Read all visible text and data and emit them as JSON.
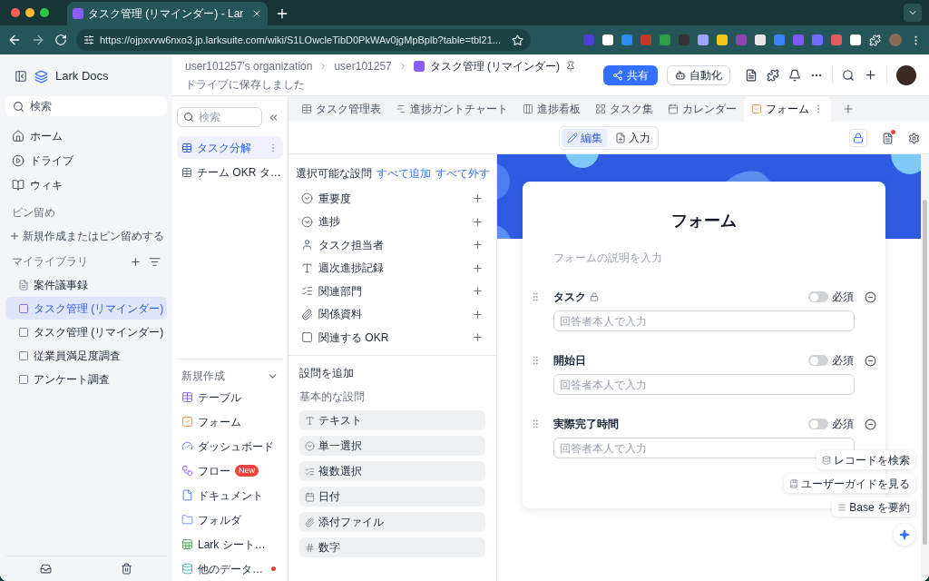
{
  "browser": {
    "tab_title": "タスク管理 (リマインダー) - Lar",
    "url": "https://ojpxvvw6nxo3.jp.larksuite.com/wiki/S1LOwcleTibD0PkWAv0jgMpBplb?table=tbl21..."
  },
  "sidebar": {
    "app_name": "Lark Docs",
    "search_placeholder": "検索",
    "nav": [
      {
        "label": "ホーム",
        "kind": "home"
      },
      {
        "label": "ドライブ",
        "kind": "drive"
      },
      {
        "label": "ウィキ",
        "kind": "wiki"
      }
    ],
    "pinned_heading": "ピン留め",
    "pin_action": "新規作成またはピン留めする",
    "library_heading": "マイライブラリ",
    "library": [
      {
        "label": "案件議事録",
        "kind": "doc",
        "selected": false
      },
      {
        "label": "タスク管理 (リマインダー)",
        "kind": "base",
        "selected": true
      },
      {
        "label": "タスク管理 (リマインダー)",
        "kind": "base",
        "selected": false
      },
      {
        "label": "従業員満足度調査",
        "kind": "base",
        "selected": false
      },
      {
        "label": "アンケート調査",
        "kind": "base",
        "selected": false
      }
    ]
  },
  "header": {
    "breadcrumb": [
      "user101257's organization",
      "user101257"
    ],
    "doc_title": "タスク管理 (リマインダー)",
    "saved_note": "ドライブに保存しました",
    "share_button": "共有",
    "automate_button": "自動化"
  },
  "tables_panel": {
    "search_placeholder": "検索",
    "tables": [
      {
        "label": "タスク分解",
        "selected": true
      },
      {
        "label": "チーム OKR タ…",
        "selected": false
      }
    ],
    "create_heading": "新規作成",
    "create_items": [
      {
        "label": "テーブル",
        "kind": "table",
        "dot": false
      },
      {
        "label": "フォーム",
        "kind": "form",
        "dot": false
      },
      {
        "label": "ダッシュボード",
        "kind": "dashboard",
        "dot": false
      },
      {
        "label": "フロー",
        "kind": "flow",
        "badge": "New",
        "dot": false
      },
      {
        "label": "ドキュメント",
        "kind": "document",
        "dot": false
      },
      {
        "label": "フォルダ",
        "kind": "folder",
        "dot": false
      },
      {
        "label": "Lark シート…",
        "kind": "sheet",
        "dot": false
      },
      {
        "label": "他のデータ…",
        "kind": "data",
        "dot": true
      }
    ]
  },
  "view_tabs": [
    {
      "label": "タスク管理表",
      "kind": "grid",
      "selected": false
    },
    {
      "label": "進捗ガントチャート",
      "kind": "gantt",
      "selected": false
    },
    {
      "label": "進捗看板",
      "kind": "kanban",
      "selected": false
    },
    {
      "label": "タスク集",
      "kind": "gallery",
      "selected": false
    },
    {
      "label": "カレンダー",
      "kind": "calendar",
      "selected": false
    },
    {
      "label": "フォーム",
      "kind": "form",
      "selected": true
    }
  ],
  "mode_toggle": [
    {
      "label": "編集",
      "kind": "edit",
      "selected": true
    },
    {
      "label": "入力",
      "kind": "fill",
      "selected": false
    }
  ],
  "fields_panel": {
    "heading": "選択可能な設問",
    "add_all": "すべて追加",
    "remove_all": "すべて外す",
    "fields": [
      {
        "label": "重要度",
        "kind": "select"
      },
      {
        "label": "進捗",
        "kind": "select"
      },
      {
        "label": "タスク担当者",
        "kind": "person"
      },
      {
        "label": "週次進捗記録",
        "kind": "text"
      },
      {
        "label": "関連部門",
        "kind": "multi"
      },
      {
        "label": "関係資料",
        "kind": "attach"
      },
      {
        "label": "関連する OKR",
        "kind": "link"
      }
    ],
    "add_heading": "設問を追加",
    "basic_heading": "基本的な設問",
    "question_types": [
      {
        "label": "テキスト",
        "kind": "text"
      },
      {
        "label": "単一選択",
        "kind": "select"
      },
      {
        "label": "複数選択",
        "kind": "multi"
      },
      {
        "label": "日付",
        "kind": "date"
      },
      {
        "label": "添付ファイル",
        "kind": "attach"
      },
      {
        "label": "数字",
        "kind": "number"
      }
    ]
  },
  "form": {
    "title": "フォーム",
    "description_placeholder": "フォームの説明を入力",
    "questions": [
      {
        "label": "タスク",
        "locked": true,
        "required": false,
        "required_label": "必須",
        "placeholder": "回答者本人で入力"
      },
      {
        "label": "開始日",
        "locked": false,
        "required": false,
        "required_label": "必須",
        "placeholder": "回答者本人で入力"
      },
      {
        "label": "実際完了時間",
        "locked": false,
        "required": false,
        "required_label": "必須",
        "placeholder": "回答者本人で入力"
      }
    ]
  },
  "assist": [
    {
      "label": "レコードを検索",
      "kind": "search"
    },
    {
      "label": "ユーザーガイドを見る",
      "kind": "guide"
    },
    {
      "label": "Base を要約",
      "kind": "summary"
    }
  ]
}
